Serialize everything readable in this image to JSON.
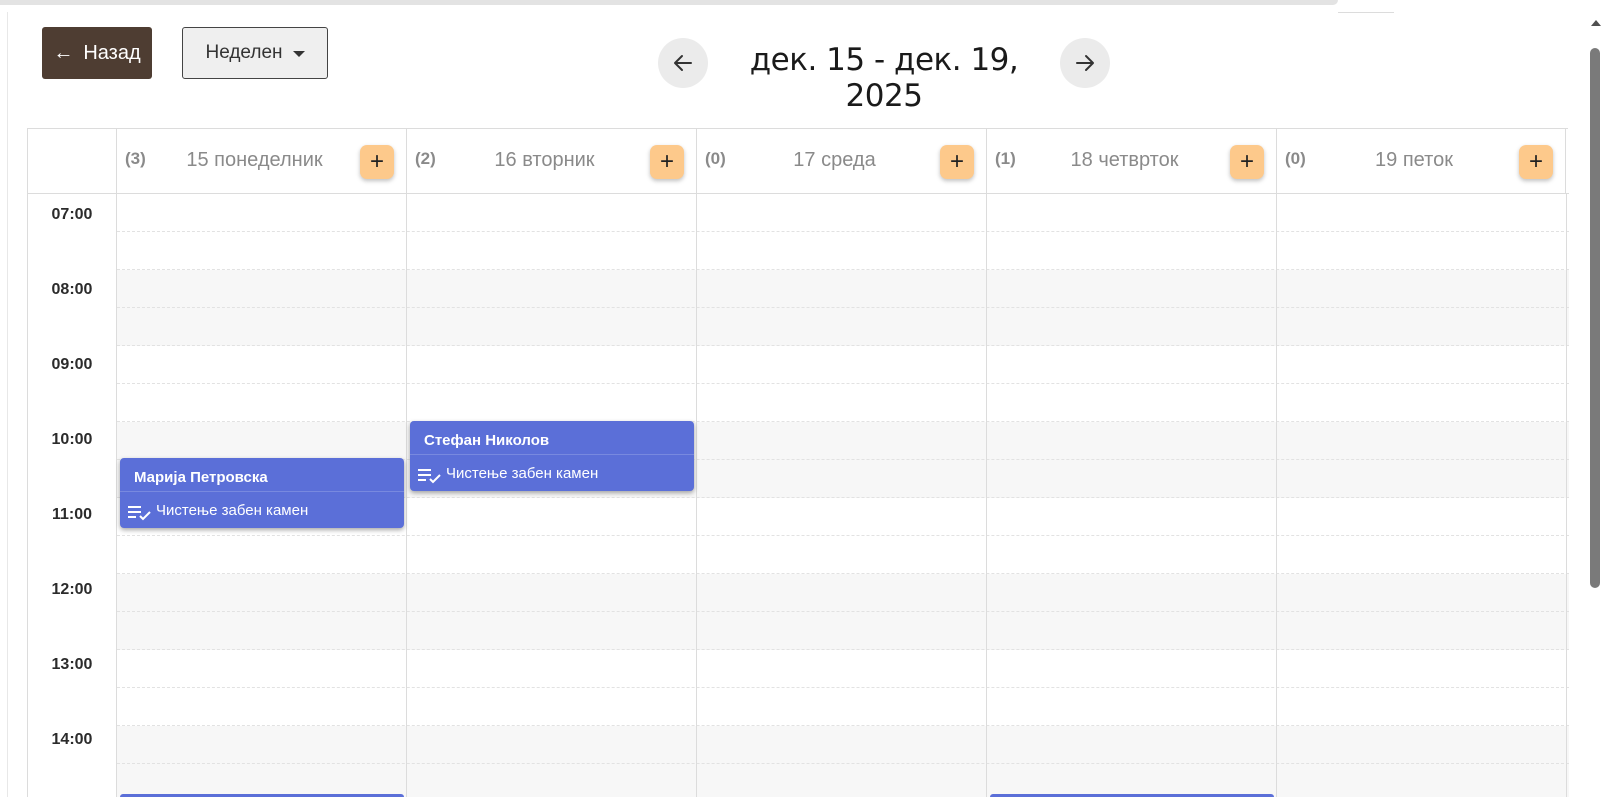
{
  "toolbar": {
    "back_label": "Назад",
    "view_label": "Неделен"
  },
  "range": {
    "title": "дек. 15 - дек. 19, 2025"
  },
  "days": [
    {
      "count": "(3)",
      "label": "15 понеделник"
    },
    {
      "count": "(2)",
      "label": "16 вторник"
    },
    {
      "count": "(0)",
      "label": "17 среда"
    },
    {
      "count": "(1)",
      "label": "18 четврток"
    },
    {
      "count": "(0)",
      "label": "19 петок"
    }
  ],
  "add_label": "+",
  "times": [
    "07:00",
    "08:00",
    "09:00",
    "10:00",
    "11:00",
    "12:00",
    "13:00",
    "14:00"
  ],
  "events": [
    {
      "name": "Марија Петровска",
      "service": "Чистење забен камен",
      "service_icon": "checklist-icon"
    },
    {
      "name": "Стефан Николов",
      "service": "Чистење забен камен",
      "service_icon": "checklist-icon"
    }
  ],
  "colors": {
    "back_button": "#4e3d32",
    "add_button": "#fdc98b",
    "event": "#5b6fd8"
  }
}
